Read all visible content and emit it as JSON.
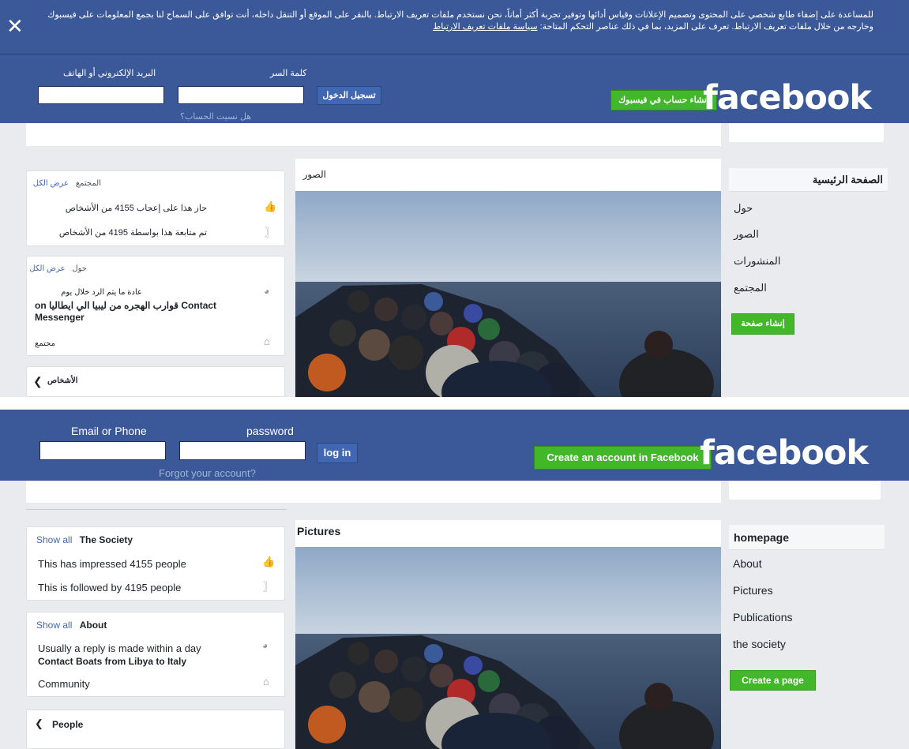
{
  "arabic": {
    "cookie": {
      "line1": "للمساعدة على إضفاء طابع شخصي على المحتوى وتصميم الإعلانات وقياس أدائها وتوفير تجربة أكثر أماناً، نحن نستخدم ملفات تعريف الارتباط. بالنقر على الموقع أو التنقل داخله، أنت توافق على السماح لنا بجمع المعلومات على فيسبوك",
      "line2": "وخارجه من خلال ملفات تعريف الارتباط. تعرف على المزيد، بما في ذلك عناصر التحكم المتاحة:",
      "link": "سياسة ملفات تعريف الارتباط",
      "close": "✕"
    },
    "header": {
      "logo": "facebook",
      "create_account": "إنشاء حساب في فيسبوك",
      "email_label": "البريد الإلكتروني أو الهاتف",
      "password_label": "كلمة السر",
      "login": "تسجيل الدخول",
      "forgot": "هل نسيت الحساب؟"
    },
    "nav": {
      "home": "الصفحة الرئيسية",
      "about": "حول",
      "photos": "الصور",
      "posts": "المنشورات",
      "community": "المجتمع",
      "create_page": "إنشاء صفحة"
    },
    "photos_title": "الصور",
    "community_card": {
      "title": "المجتمع",
      "show_all": "عرض الكل",
      "likes": "حاز هذا على إعجاب 4155 من الأشخاص",
      "follows": "تم متابعة هذا بواسطة 4195 من الأشخاص"
    },
    "about_card": {
      "title": "حول",
      "show_all": "عرض الكل",
      "reply": "عادة ما يتم الرد خلال يوم",
      "contact": "on قوارب الهجره من ليبيا الي ايطاليا Contact",
      "contact2": "Messenger",
      "category": "مجتمع"
    },
    "people_card": {
      "title": "الأشخاص"
    }
  },
  "english": {
    "header": {
      "logo": "facebook",
      "create_account": "Create an account in Facebook",
      "email_label": "Email or Phone",
      "password_label": "password",
      "login": "log in",
      "forgot": "Forgot your account?"
    },
    "nav": {
      "home": "homepage",
      "about": "About",
      "photos": "Pictures",
      "posts": "Publications",
      "community": "the society",
      "create_page": "Create a page"
    },
    "photos_title": "Pictures",
    "community_card": {
      "title": "The Society",
      "show_all": "Show all",
      "likes": "This has impressed 4155 people",
      "follows": "This is followed by 4195 people"
    },
    "about_card": {
      "title": "About",
      "show_all": "Show all",
      "reply": "Usually a reply is made within a day",
      "contact": "Contact Boats from Libya to Italy",
      "category": "Community"
    },
    "people_card": {
      "title": "People"
    }
  },
  "colors": {
    "brand": "#3b5998",
    "background": "#e9ebee",
    "green": "#42b72a",
    "link": "#4267b2"
  },
  "icons": {
    "close": "close-icon",
    "like": "thumbs-up-icon",
    "follow": "rss-icon",
    "messenger": "messenger-icon",
    "category": "briefcase-icon",
    "chevron": "chevron-icon"
  }
}
